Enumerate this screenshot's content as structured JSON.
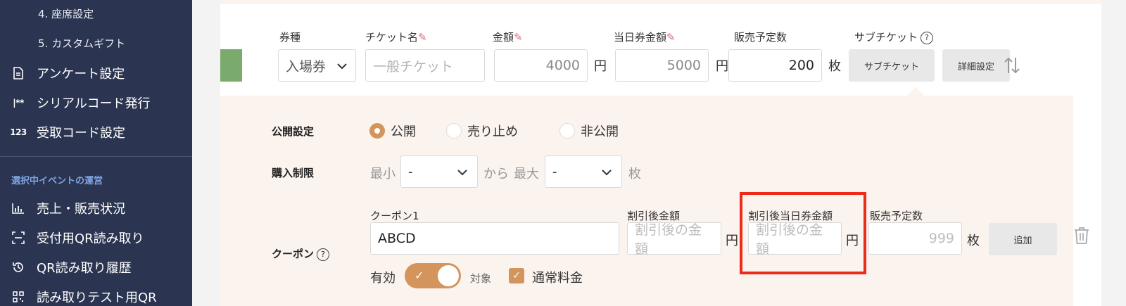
{
  "sidebar": {
    "sub_items": [
      {
        "label": "4. 座席設定"
      },
      {
        "label": "5. カスタムギフト"
      }
    ],
    "items": [
      {
        "label": "アンケート設定",
        "icon": "document-icon"
      },
      {
        "label": "シリアルコード発行",
        "icon": "serial-code-icon",
        "icon_text": "|**"
      },
      {
        "label": "受取コード設定",
        "icon": "code-123-icon",
        "icon_text": "123"
      }
    ],
    "section_title": "選択中イベントの運営",
    "section_items": [
      {
        "label": "売上・販売状況",
        "icon": "bar-chart-icon"
      },
      {
        "label": "受付用QR読み取り",
        "icon": "qr-scan-icon"
      },
      {
        "label": "QR読み取り履歴",
        "icon": "history-icon"
      },
      {
        "label": "読み取りテスト用QR",
        "icon": "qr-code-icon"
      }
    ]
  },
  "ticket_row": {
    "labels": {
      "type": "券種",
      "name": "チケット名",
      "price": "金額",
      "day_price": "当日券金額",
      "planned": "販売予定数",
      "sub_ticket": "サブチケット"
    },
    "type_value": "入場券",
    "name_placeholder": "一般チケット",
    "price_value": "4000",
    "day_price_value": "5000",
    "planned_value": "200",
    "yen": "円",
    "sheets": "枚",
    "sub_ticket_button": "サブチケット",
    "detail_button": "詳細設定"
  },
  "detail": {
    "visibility_label": "公開設定",
    "visibility_options": [
      {
        "label": "公開",
        "selected": true
      },
      {
        "label": "売り止め",
        "selected": false
      },
      {
        "label": "非公開",
        "selected": false
      }
    ],
    "limit_label": "購入制限",
    "min_label": "最小",
    "min_value": "-",
    "from_label": "から",
    "max_label": "最大",
    "max_value": "-",
    "limit_unit": "枚",
    "coupon_label": "クーポン",
    "coupon_name_label": "クーポン1",
    "coupon_name_value": "ABCD",
    "discount_price_label": "割引後金額",
    "discount_price_placeholder": "割引後の金額",
    "discount_day_price_label": "割引後当日券金額",
    "discount_day_price_placeholder": "割引後の金額",
    "coupon_planned_label": "販売予定数",
    "coupon_planned_placeholder": "999",
    "yen": "円",
    "sheets": "枚",
    "add_button": "追加",
    "enabled_label": "有効",
    "target_label": "対象",
    "normal_fee_label": "通常料金"
  },
  "colors": {
    "sidebar_bg": "#2b3450",
    "accent": "#d4955c",
    "highlight": "#ee2a19",
    "green_tab": "#7aab6c"
  }
}
